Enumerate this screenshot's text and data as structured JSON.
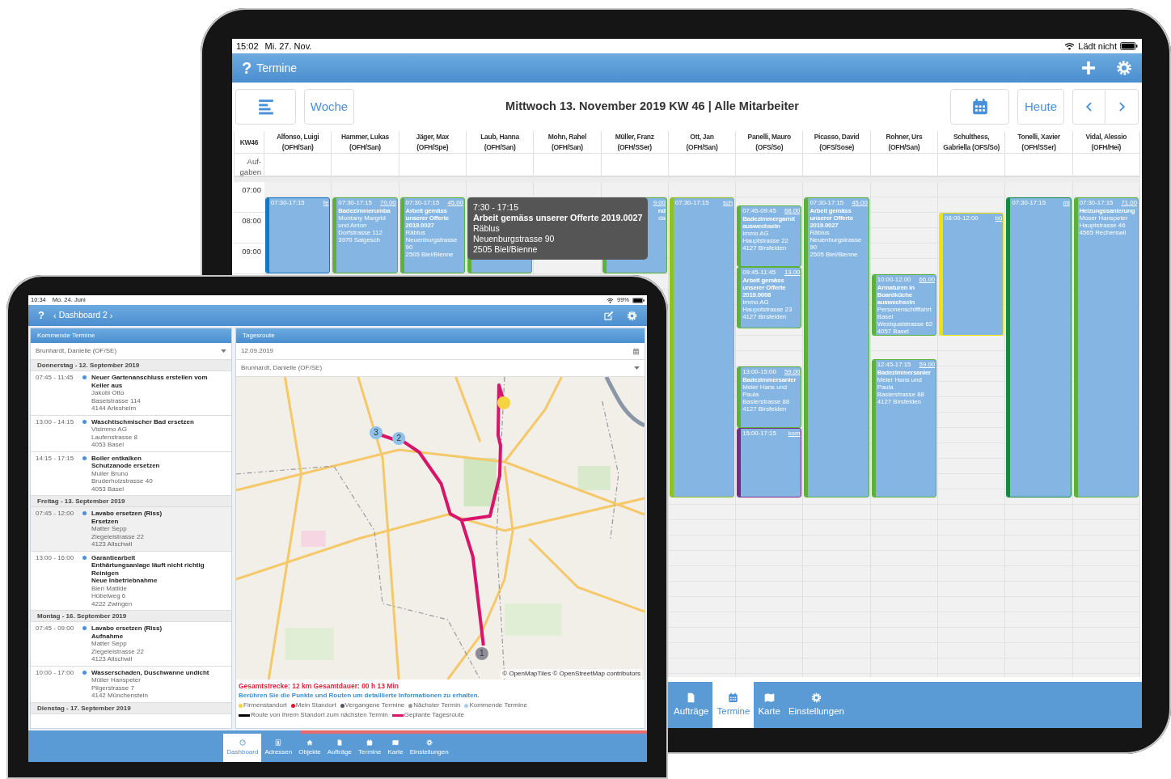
{
  "back_tablet": {
    "status_bar": {
      "time": "15:02",
      "date": "Mi. 27. Nov.",
      "charging": "Lädt nicht"
    },
    "header": {
      "help": "?",
      "title": "Termine"
    },
    "toolbar": {
      "view_button": "Woche",
      "title": "Mittwoch 13. November 2019 KW 46 | Alle Mitarbeiter",
      "today_button": "Heute"
    },
    "calendar": {
      "week": "KW46",
      "tasks_label": "Auf-gaben",
      "hours": [
        "07:00",
        "08:00",
        "09:00"
      ],
      "columns": [
        {
          "lines": [
            "Alfonso, Luigi",
            "(OFH/San)"
          ],
          "events": [
            {
              "time": "07:30-17:15",
              "tag": "fe",
              "color": "#1677c1"
            }
          ]
        },
        {
          "lines": [
            "Hammer, Lukas",
            "(OFH/San)"
          ],
          "events": [
            {
              "time": "07:30-17:15",
              "tag": "70.00",
              "title": "Badezimmerumba",
              "details": [
                "Montany Margrid und Anton",
                "Dorfstrasse 112",
                "3970 Salgesch"
              ],
              "color": "#5cb137"
            }
          ]
        },
        {
          "lines": [
            "Jäger, Max",
            "(OFH/Spe)"
          ],
          "events": [
            {
              "time": "07:30-17:15",
              "tag": "45.00",
              "title": "Arbeit gemäss unserer Offerte 2019.0027",
              "details": [
                "Räblus",
                "Neuenburgstrasse 90",
                "2505 Biel/Bienne"
              ],
              "color": "#5cb137"
            }
          ]
        },
        {
          "lines": [
            "Laub, Hanna",
            "(OFH/San)"
          ],
          "events": [
            {
              "color": "#5cb137"
            }
          ]
        },
        {
          "lines": [
            "Mohn, Rahel",
            "(OFH/San)"
          ]
        },
        {
          "lines": [
            "Müller, Franz",
            "(OFH/SSer)"
          ],
          "events": [
            {
              "tag": "9.00",
              "title": "nd",
              "details": [
                "da"
              ],
              "clipped": true,
              "color": "#5cb137"
            }
          ]
        },
        {
          "lines": [
            "Ott, Jan",
            "(OFH/San)"
          ],
          "events": [
            {
              "time": "07:30-17:15",
              "tag": "sch",
              "color": "#8ec21f"
            }
          ]
        },
        {
          "lines": [
            "Panelli, Mauro",
            "(OFS/So)"
          ],
          "events": [
            {
              "time": "07:45-09:45",
              "tag": "68.00",
              "title": "Badezimmergarnit auswechseln",
              "details": [
                "Immo AG",
                "Hauptstrasse 22",
                "4127 Birsfelden"
              ],
              "color": "#5cb137"
            },
            {
              "time": "09:45-11:45",
              "tag": "13.00",
              "title": "Arbeit gemäss unserer Offerte 2019.0008",
              "details": [
                "Immo AG",
                "Haupotstrasse 23",
                "4127 Birsfelden"
              ],
              "color": "#5cb137"
            },
            {
              "time": "13:00-15:00",
              "tag": "59.00",
              "title": "Badezimmersanier",
              "details": [
                "Meier Hans und Paula",
                "Baslerstrasse 88",
                "4127 Birsfelden"
              ],
              "color": "#5cb137"
            },
            {
              "time": "15:00-17:15",
              "tag": "kom",
              "color": "#7b2a84"
            }
          ]
        },
        {
          "lines": [
            "Picasso, David",
            "(OFS/Sose)"
          ],
          "events": [
            {
              "time": "07:30-17:15",
              "tag": "45.00",
              "title": "Arbeit gemäss unserer Offerte 2019.0027",
              "details": [
                "Räblus",
                "Neuenburgstrasse 90",
                "2505 Biel/Bienne"
              ],
              "color": "#5cb137"
            }
          ]
        },
        {
          "lines": [
            "Rohner, Urs",
            "(OFH/San)"
          ],
          "events": [
            {
              "time": "10:00-12:00",
              "tag": "66.00",
              "title": "Armaturen in Boardküche auswechseln",
              "details": [
                "Personenschifffahrt Basel",
                "Westquaistrasse 62",
                "4057 Basel"
              ],
              "color": "#5cb137"
            },
            {
              "time": "12:45-17:15",
              "tag": "59.00",
              "title": "Badezimmersanier",
              "details": [
                "Meier Hans und Paula",
                "Baslerstrasse 88",
                "4127 Birsfelden"
              ],
              "color": "#5cb137"
            }
          ]
        },
        {
          "lines": [
            "Schulthess,",
            "Gabriella (OFS/So)"
          ],
          "events": [
            {
              "time": "08:00-12:00",
              "tag": "bü",
              "color": "#f3e400"
            }
          ]
        },
        {
          "lines": [
            "Tonelli, Xavier",
            "(OFH/SSer)"
          ],
          "events": [
            {
              "time": "07:30-17:15",
              "tag": "mi",
              "color": "#138a3d"
            }
          ]
        },
        {
          "lines": [
            "Vidal, Alessio",
            "(OFH/Hei)"
          ],
          "events": [
            {
              "time": "07:30-17:15",
              "tag": "71.00",
              "title": "Heizungssanierung",
              "details": [
                "Moser Hanspeter",
                "Hauptstrasse 46",
                "4565 Recherswil"
              ],
              "color": "#5cb137"
            }
          ]
        }
      ]
    },
    "tooltip": {
      "time": "7:30 - 17:15",
      "title": "Arbeit gemäss unserer Offerte 2019.0027",
      "details": [
        "Räblus",
        "Neuenburgstrasse 90",
        "2505 Biel/Bienne"
      ]
    },
    "tabs": [
      {
        "label": "Aufträge",
        "selected": false
      },
      {
        "label": "Termine",
        "selected": true
      },
      {
        "label": "Karte",
        "selected": false
      },
      {
        "label": "Einstellungen",
        "selected": false
      }
    ]
  },
  "front_tablet": {
    "status_bar": {
      "time": "10:34",
      "date": "Mo. 24. Juni",
      "battery": "99%"
    },
    "header": {
      "help": "?",
      "prev": "‹",
      "title": "Dashboard 2",
      "next": "›"
    },
    "upcoming": {
      "title": "Kommende Termine",
      "employee": "Brunhardt, Danielle (OF/SE)",
      "days": [
        {
          "label": "Donnerstag - 12. September 2019",
          "appointments": [
            {
              "time": "07:45 - 11:45",
              "selected": false,
              "titles": [
                "Neuer Gartenanschluss erstellen vom Keller aus"
              ],
              "details": [
                "Jakobi Otto",
                "Baselstrasse 114",
                "4144 Arlesheim"
              ]
            },
            {
              "time": "13:00 - 14:15",
              "selected": false,
              "titles": [
                "Waschtischmischer Bad ersetzen"
              ],
              "details": [
                "Visimmo AG",
                "Laufenstrasse 8",
                "4053 Basel"
              ]
            },
            {
              "time": "14:15 - 17:15",
              "selected": false,
              "titles": [
                "Boiler entkalken",
                "Schutzanode ersetzen"
              ],
              "details": [
                "Muller Bruno",
                "Bruderholzstrasse 40",
                "4053 Basel"
              ]
            }
          ]
        },
        {
          "label": "Freitag - 13. September 2019",
          "appointments": [
            {
              "time": "07:45 - 12:00",
              "selected": true,
              "titles": [
                "Lavabo ersetzen (Riss)",
                "Ersetzen"
              ],
              "details": [
                "Matter Sepp",
                "Ziegeleistrasse 22",
                "4123 Allschwil"
              ]
            },
            {
              "time": "13:00 - 16:00",
              "selected": false,
              "titles": [
                "Garantiearbeit",
                "Enthärtungsanlage läuft nicht richtig",
                "Reinigen",
                "Neue Inbetriebnahme"
              ],
              "details": [
                "Bieri Matilde",
                "Hübelweg 6",
                "4222 Zwingen"
              ]
            }
          ]
        },
        {
          "label": "Montag - 16. September 2019",
          "appointments": [
            {
              "time": "07:45 - 09:00",
              "selected": false,
              "titles": [
                "Lavabo ersetzen (Riss)",
                "Aufnahme"
              ],
              "details": [
                "Matter Sepp",
                "Ziegeleistrasse 22",
                "4123 Allschwil"
              ]
            },
            {
              "time": "10:00 - 17:00",
              "selected": false,
              "titles": [
                "Wasserschaden, Duschwanne undicht"
              ],
              "details": [
                "Müller Hanspeter",
                "Pilgerstrasse 7",
                "4142 Münchenstein"
              ]
            }
          ]
        },
        {
          "label": "Dienstag - 17. September 2019"
        }
      ]
    },
    "route": {
      "title": "Tagesroute",
      "date": "12.09.2019",
      "employee": "Brunhardt, Danielle (OF/SE)",
      "markers": [
        {
          "label": "1",
          "color": "#8e8d97"
        },
        {
          "label": "2",
          "color": "#8fc2ea"
        },
        {
          "label": "3",
          "color": "#8fc2ea"
        }
      ],
      "attribution": "© OpenMapTiles © OpenStreetMap contributors",
      "summary": "Gesamtstrecke: 12 km Gesamtdauer: 00 h 13 Min",
      "hint": "Berühren Sie die Punkte und Routen um detaillierte Informationen zu erhalten.",
      "legend_points": [
        {
          "label": "Firmenstandort",
          "color": "#f5d442"
        },
        {
          "label": "Mein Standort",
          "color": "#e3122b"
        },
        {
          "label": "Vergangene Termine",
          "color": "#55555f"
        },
        {
          "label": "Nächster Termin",
          "color": "#9a9a9a"
        },
        {
          "label": "Kommende Termine",
          "color": "#a9d0f0"
        }
      ],
      "legend_lines": [
        {
          "label": "Route von Ihrem Standort zum nächsten Termin",
          "color": "#000000"
        },
        {
          "label": "Geplante Tagesroute",
          "color": "#d8156b"
        }
      ]
    },
    "progress": {
      "level": 0.44
    },
    "tabs": [
      {
        "label": "Dashboard",
        "selected": true
      },
      {
        "label": "Adressen",
        "selected": false
      },
      {
        "label": "Objekte",
        "selected": false
      },
      {
        "label": "Aufträge",
        "selected": false
      },
      {
        "label": "Termine",
        "selected": false
      },
      {
        "label": "Karte",
        "selected": false
      },
      {
        "label": "Einstellungen",
        "selected": false
      }
    ]
  }
}
